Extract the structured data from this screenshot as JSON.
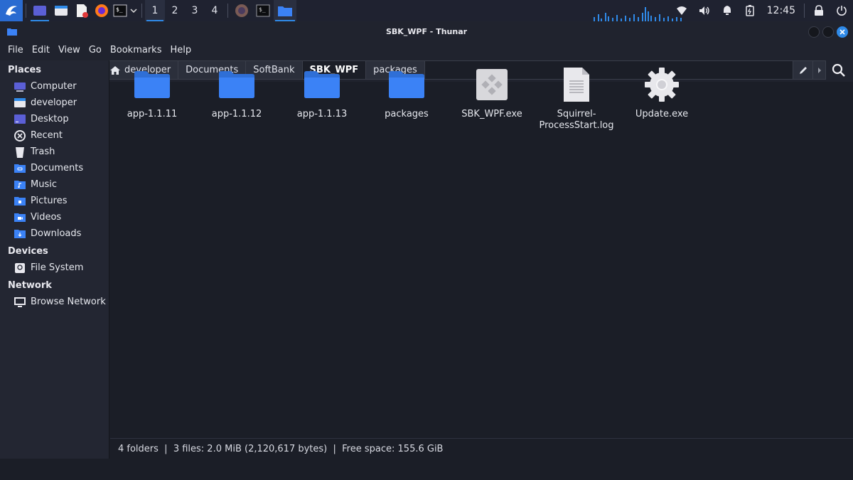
{
  "panel": {
    "workspaces": [
      "1",
      "2",
      "3",
      "4"
    ],
    "clock": "12:45"
  },
  "window": {
    "title": "SBK_WPF - Thunar"
  },
  "menubar": [
    "File",
    "Edit",
    "View",
    "Go",
    "Bookmarks",
    "Help"
  ],
  "pathbar": {
    "crumbs": [
      "developer",
      "Documents",
      "SoftBank",
      "SBK_WPF",
      "packages"
    ],
    "current": "SBK_WPF"
  },
  "sidebar": {
    "places_header": "Places",
    "places": [
      {
        "label": "Computer",
        "icon": "computer-icon"
      },
      {
        "label": "developer",
        "icon": "home-folder-icon"
      },
      {
        "label": "Desktop",
        "icon": "desktop-icon"
      },
      {
        "label": "Recent",
        "icon": "recent-icon"
      },
      {
        "label": "Trash",
        "icon": "trash-icon"
      },
      {
        "label": "Documents",
        "icon": "documents-folder-icon"
      },
      {
        "label": "Music",
        "icon": "music-folder-icon"
      },
      {
        "label": "Pictures",
        "icon": "pictures-folder-icon"
      },
      {
        "label": "Videos",
        "icon": "videos-folder-icon"
      },
      {
        "label": "Downloads",
        "icon": "downloads-folder-icon"
      }
    ],
    "devices_header": "Devices",
    "devices": [
      {
        "label": "File System",
        "icon": "drive-icon"
      }
    ],
    "network_header": "Network",
    "network": [
      {
        "label": "Browse Network",
        "icon": "network-icon"
      }
    ]
  },
  "files": [
    {
      "name": "app-1.1.11",
      "type": "folder"
    },
    {
      "name": "app-1.1.12",
      "type": "folder"
    },
    {
      "name": "app-1.1.13",
      "type": "folder"
    },
    {
      "name": "packages",
      "type": "folder"
    },
    {
      "name": "SBK_WPF.exe",
      "type": "exe"
    },
    {
      "name": "Squirrel-ProcessStart.log",
      "type": "log"
    },
    {
      "name": "Update.exe",
      "type": "gear"
    }
  ],
  "status": "4 folders  |  3 files: 2.0 MiB (2,120,617 bytes)  |  Free space: 155.6 GiB",
  "colors": {
    "accent": "#2f8ae8",
    "folder": "#3b82f6",
    "background": "#1b1e27",
    "sidebar": "#232632"
  }
}
